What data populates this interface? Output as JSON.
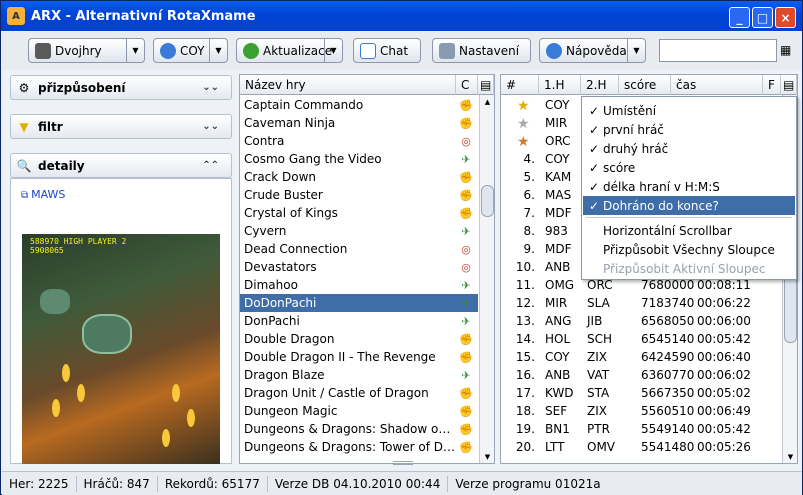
{
  "window": {
    "title": "ARX - Alternativní RotaXmame",
    "app_icon": "arx-logo-icon",
    "controls": [
      "minimize",
      "maximize",
      "close"
    ]
  },
  "toolbar": {
    "mode_label": "Dvojhry",
    "user_label": "COY",
    "update_label": "Aktualizace",
    "chat_label": "Chat",
    "settings_label": "Nastavení",
    "help_label": "Nápověda",
    "search_value": ""
  },
  "left": {
    "customize_label": "přizpůsobení",
    "filter_label": "filtr",
    "details_label": "detaily",
    "maws_link": "MAWS",
    "screenshot_hud_high": "HIGH",
    "screenshot_hud_p1": "588970",
    "screenshot_hud_hi": "5908065",
    "screenshot_hud_player": "PLAYER 2"
  },
  "games": {
    "header_name": "Název hry",
    "header_c": "C",
    "rows": [
      {
        "name": "Captain Commando",
        "icon": "fighter-icon"
      },
      {
        "name": "Caveman Ninja",
        "icon": "fighter-icon"
      },
      {
        "name": "Contra",
        "icon": "target-icon"
      },
      {
        "name": "Cosmo Gang the Video",
        "icon": "plane-icon"
      },
      {
        "name": "Crack Down",
        "icon": "fighter-icon"
      },
      {
        "name": "Crude Buster",
        "icon": "fighter-icon"
      },
      {
        "name": "Crystal of Kings",
        "icon": "fighter-icon"
      },
      {
        "name": "Cyvern",
        "icon": "plane-icon"
      },
      {
        "name": "Dead Connection",
        "icon": "target-icon"
      },
      {
        "name": "Devastators",
        "icon": "target-icon"
      },
      {
        "name": "Dimahoo",
        "icon": "plane-icon"
      },
      {
        "name": "DoDonPachi",
        "icon": "plane-icon",
        "selected": true
      },
      {
        "name": "DonPachi",
        "icon": "plane-icon"
      },
      {
        "name": "Double Dragon",
        "icon": "fighter-icon"
      },
      {
        "name": "Double Dragon II - The Revenge",
        "icon": "fighter-icon"
      },
      {
        "name": "Dragon Blaze",
        "icon": "plane-icon"
      },
      {
        "name": "Dragon Unit / Castle of Dragon",
        "icon": "fighter-icon"
      },
      {
        "name": "Dungeon Magic",
        "icon": "fighter-icon"
      },
      {
        "name": "Dungeons & Dragons: Shadow over...",
        "icon": "fighter-icon"
      },
      {
        "name": "Dungeons & Dragons: Tower of Doo...",
        "icon": "fighter-icon"
      }
    ]
  },
  "ranking": {
    "headers": [
      "#",
      "1.H",
      "2.H",
      "scóre",
      "čas",
      "F"
    ],
    "rows": [
      {
        "rank": "",
        "p1": "COY",
        "p2": "",
        "score": "",
        "time": "",
        "medal": "gold"
      },
      {
        "rank": "",
        "p1": "MIR",
        "p2": "",
        "score": "",
        "time": "",
        "medal": "silver"
      },
      {
        "rank": "",
        "p1": "ORC",
        "p2": "",
        "score": "",
        "time": "",
        "medal": "bronze"
      },
      {
        "rank": "4.",
        "p1": "COY",
        "p2": "",
        "score": "",
        "time": ""
      },
      {
        "rank": "5.",
        "p1": "KAM",
        "p2": "",
        "score": "",
        "time": ""
      },
      {
        "rank": "6.",
        "p1": "MAS",
        "p2": "",
        "score": "",
        "time": ""
      },
      {
        "rank": "7.",
        "p1": "MDF",
        "p2": "",
        "score": "",
        "time": ""
      },
      {
        "rank": "8.",
        "p1": "983",
        "p2": "",
        "score": "",
        "time": ""
      },
      {
        "rank": "9.",
        "p1": "MDF",
        "p2": "",
        "score": "",
        "time": ""
      },
      {
        "rank": "10.",
        "p1": "ANB",
        "p2": "",
        "score": "",
        "time": ""
      },
      {
        "rank": "11.",
        "p1": "OMG",
        "p2": "ORC",
        "score": "7680000",
        "time": "00:08:11"
      },
      {
        "rank": "12.",
        "p1": "MIR",
        "p2": "SLA",
        "score": "7183740",
        "time": "00:06:22"
      },
      {
        "rank": "13.",
        "p1": "ANG",
        "p2": "JIB",
        "score": "6568050",
        "time": "00:06:00"
      },
      {
        "rank": "14.",
        "p1": "HOL",
        "p2": "SCH",
        "score": "6545140",
        "time": "00:05:42"
      },
      {
        "rank": "15.",
        "p1": "COY",
        "p2": "ZIX",
        "score": "6424590",
        "time": "00:06:40"
      },
      {
        "rank": "16.",
        "p1": "ANB",
        "p2": "VAT",
        "score": "6360770",
        "time": "00:06:02"
      },
      {
        "rank": "17.",
        "p1": "KWD",
        "p2": "STA",
        "score": "5667350",
        "time": "00:05:02"
      },
      {
        "rank": "18.",
        "p1": "SEF",
        "p2": "ZIX",
        "score": "5560510",
        "time": "00:06:49"
      },
      {
        "rank": "19.",
        "p1": "BN1",
        "p2": "PTR",
        "score": "5549140",
        "time": "00:05:42"
      },
      {
        "rank": "20.",
        "p1": "LTT",
        "p2": "OMV",
        "score": "5541480",
        "time": "00:05:26"
      }
    ]
  },
  "column_menu": {
    "items": [
      {
        "label": "Umístění",
        "checked": true
      },
      {
        "label": "první hráč",
        "checked": true
      },
      {
        "label": "druhý hráč",
        "checked": true
      },
      {
        "label": "scóre",
        "checked": true
      },
      {
        "label": "délka hraní v H:M:S",
        "checked": true
      },
      {
        "label": "Dohráno do konce?",
        "checked": true,
        "highlighted": true
      }
    ],
    "extra": [
      {
        "label": "Horizontální Scrollbar",
        "enabled": true
      },
      {
        "label": "Přizpůsobit Všechny Sloupce",
        "enabled": true
      },
      {
        "label": "Přizpůsobit Aktivní Sloupec",
        "enabled": false
      }
    ]
  },
  "status": {
    "players": "Her: 2225",
    "hracu": "Hráčů: 847",
    "rekordu": "Rekordů: 65177",
    "db_version": "Verze DB 04.10.2010 00:44",
    "program_version": "Verze programu 01021a"
  }
}
